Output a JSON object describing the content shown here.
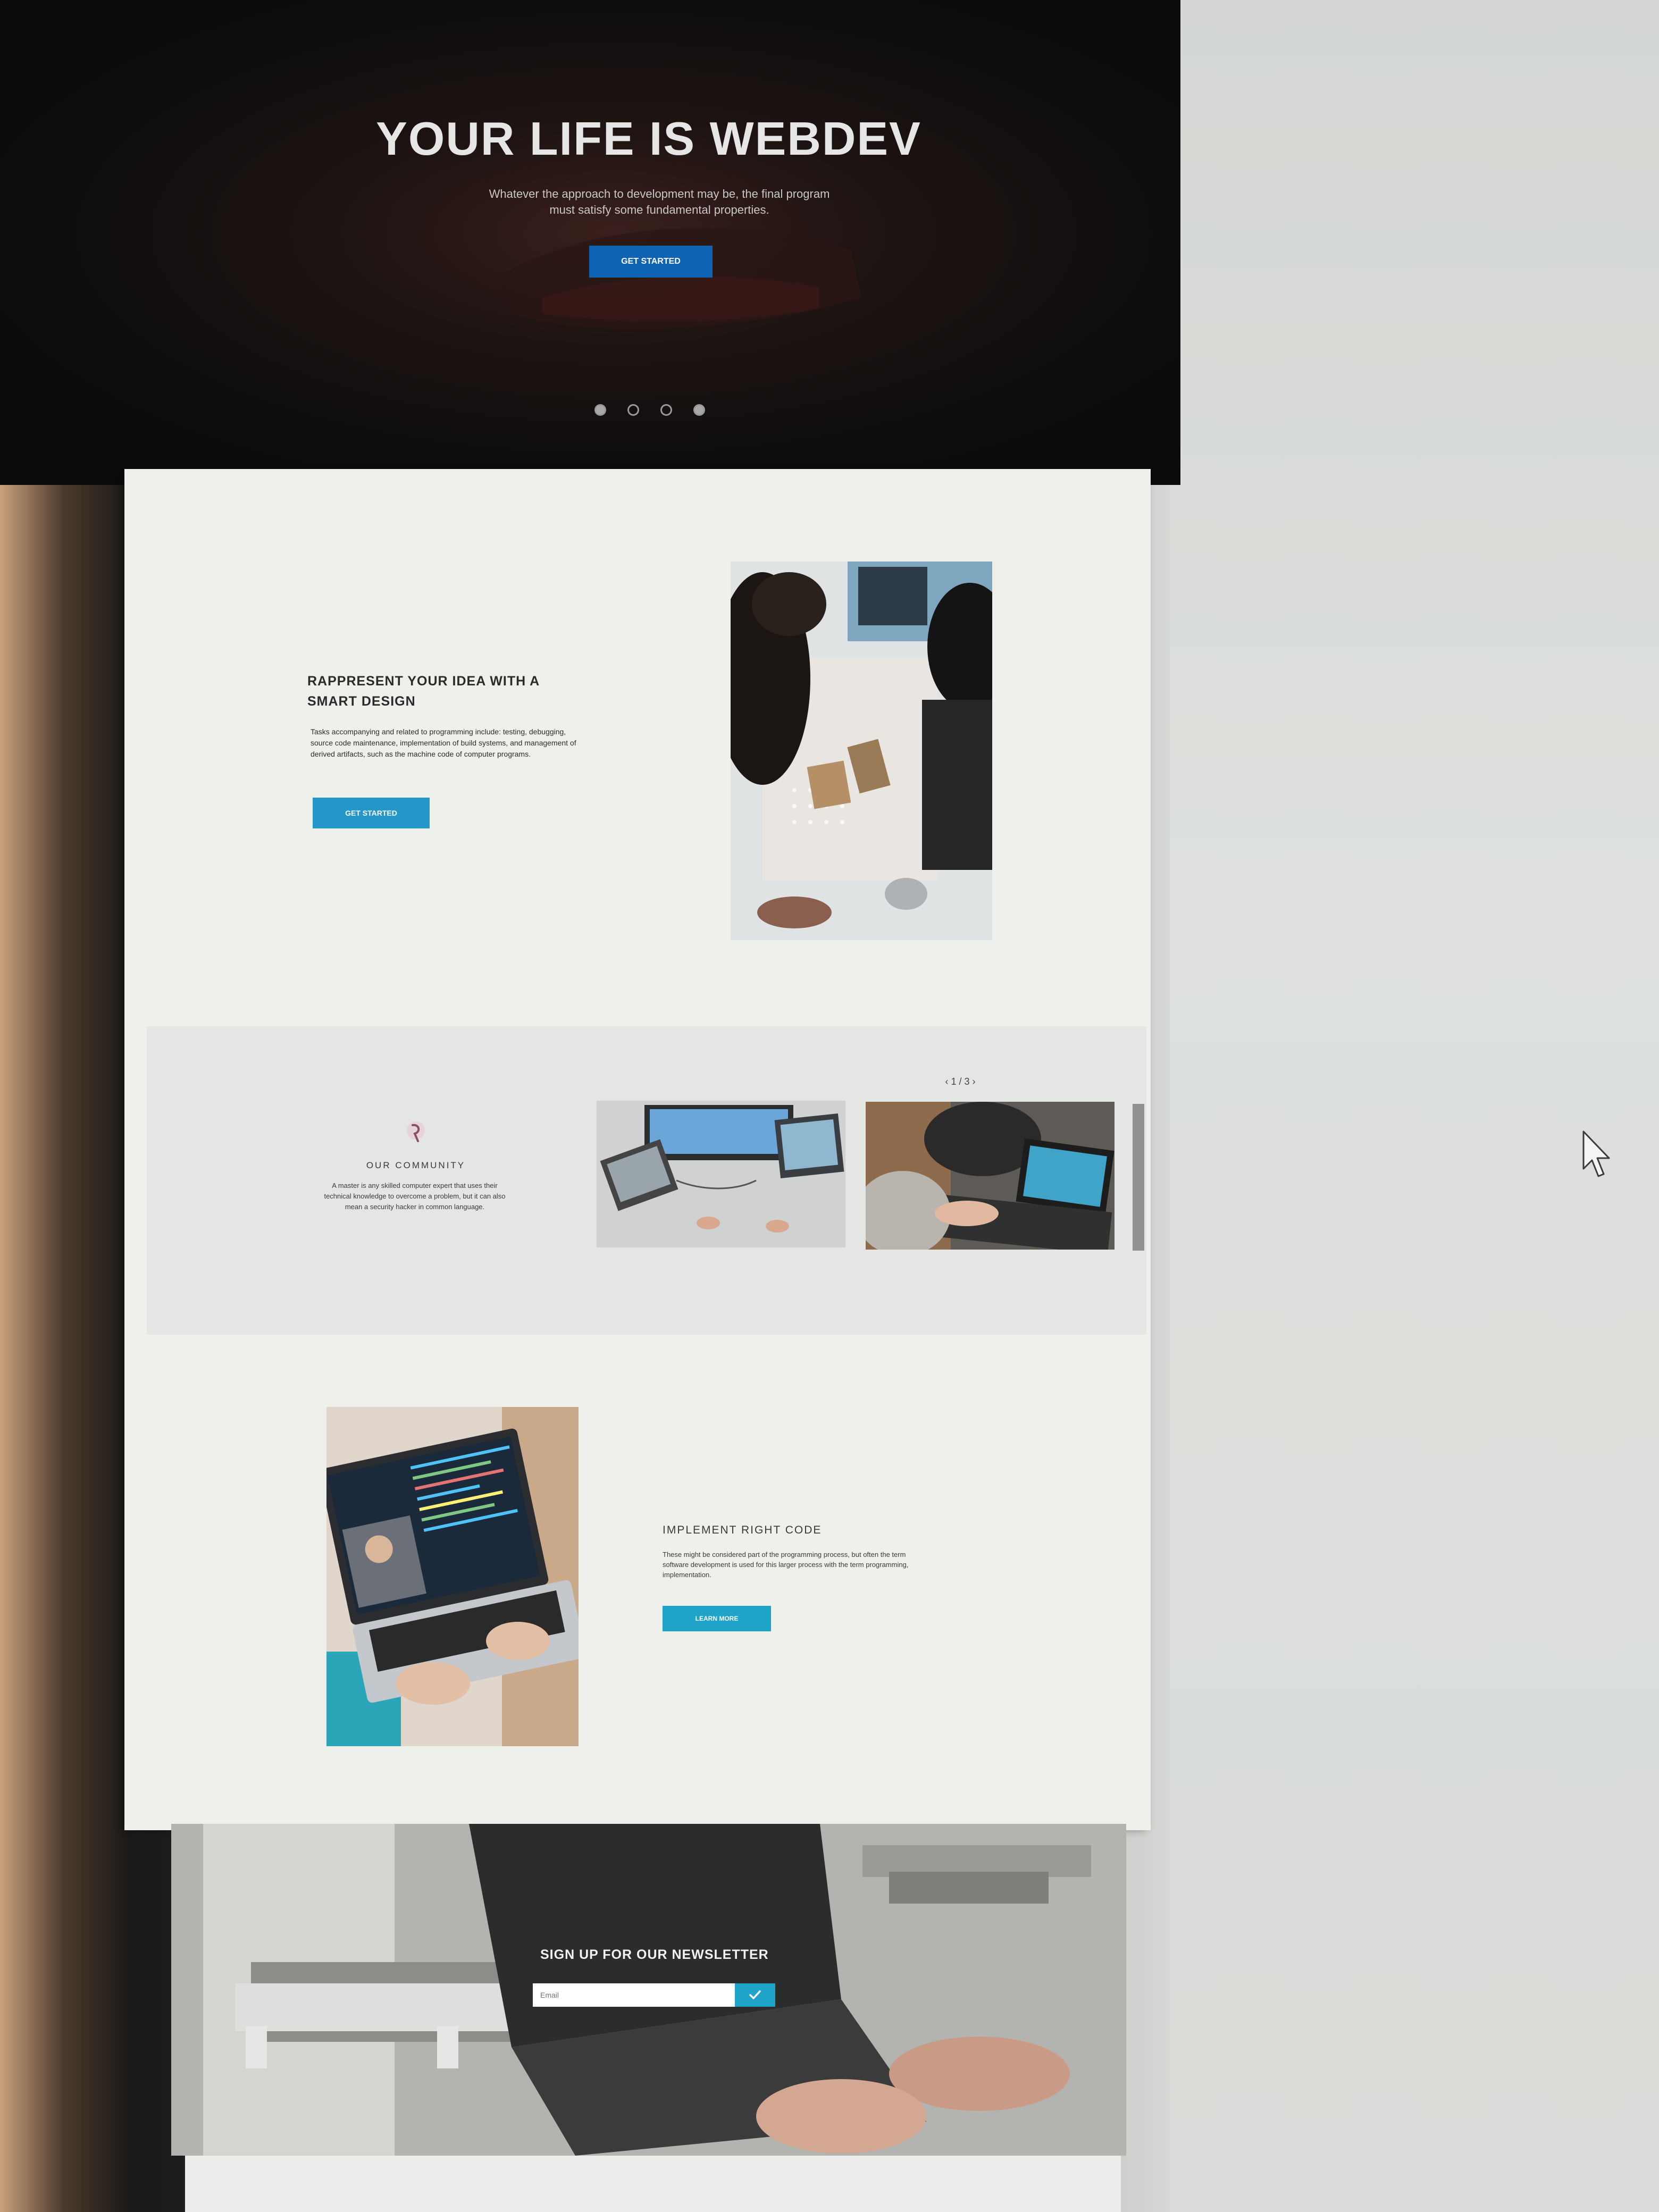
{
  "hero": {
    "title": "YOUR LIFE IS WEBDEV",
    "subtitle": "Whatever the approach to development may be, the final program must satisfy some fundamental properties.",
    "button_label": "GET STARTED",
    "slide_count": 4,
    "active_slide": 1
  },
  "feature": {
    "heading": "RAPPRESENT YOUR IDEA WITH A SMART DESIGN",
    "body": "Tasks accompanying and related to programming include: testing, debugging, source code maintenance, implementation of build systems, and management of derived artifacts, such as the machine code of computer programs.",
    "button_label": "GET STARTED"
  },
  "community": {
    "title": "OUR COMMUNITY",
    "body": "A master is any skilled computer expert that uses their technical knowledge to overcome a problem, but it can also mean a security hacker in common language.",
    "pager": "‹ 1 / 3 ›",
    "images": [
      "desk-monitors-photo",
      "laptop-car-photo",
      "partial-photo"
    ]
  },
  "implement": {
    "heading": "IMPLEMENT RIGHT CODE",
    "body": "These might be considered part of the programming process, but often the term software development is used for this larger process with the term programming, implementation.",
    "button_label": "LEARN MORE"
  },
  "newsletter": {
    "title": "SIGN UP FOR OUR NEWSLETTER",
    "email_placeholder": "Email",
    "submit_icon": "check-icon"
  },
  "colors": {
    "accent_blue": "#0f63b4",
    "accent_cyan": "#1fa3c9",
    "hero_bg": "#0e0d0d",
    "page_bg": "#eef0ec"
  }
}
